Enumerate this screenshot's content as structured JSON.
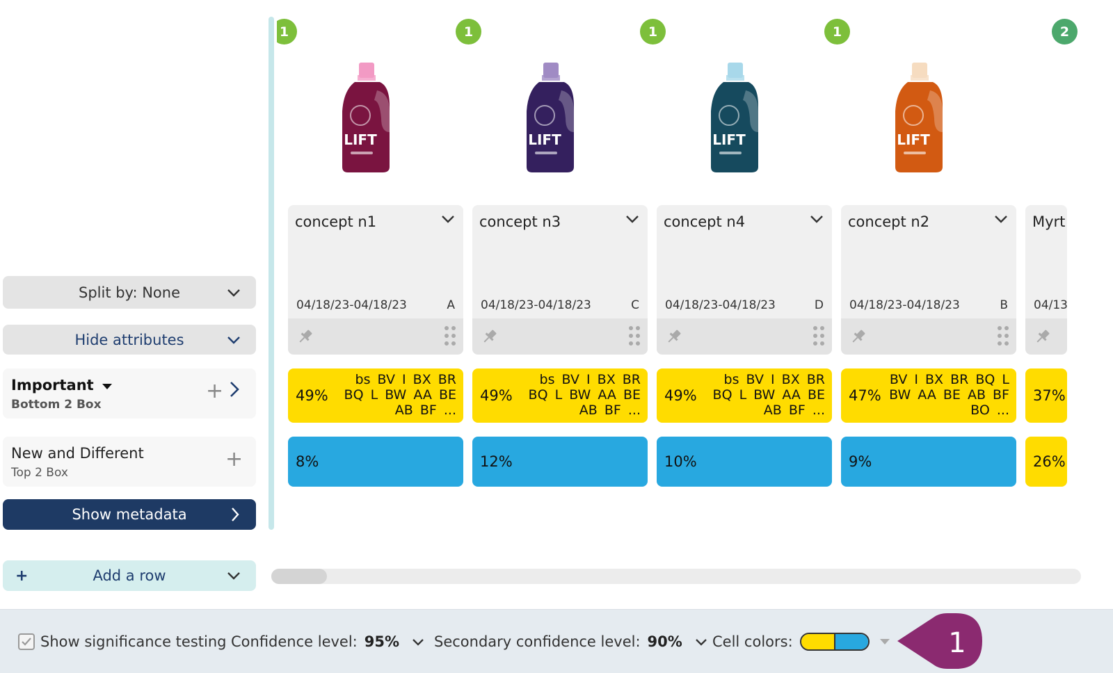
{
  "sidebar": {
    "split_label": "Split by: None",
    "hide_attributes_label": "Hide attributes",
    "attributes": [
      {
        "title": "Important",
        "subtitle": "Bottom 2 Box"
      },
      {
        "title": "New and Different",
        "subtitle": "Top 2 Box"
      }
    ],
    "show_metadata_label": "Show metadata",
    "add_row_label": "Add a row"
  },
  "columns": [
    {
      "badge": "1",
      "name": "concept n1",
      "date": "04/18/23-04/18/23",
      "letter": "A",
      "bottle_color": "#7a1440",
      "cap_color": "#f29ac4",
      "row1_pct": "49%",
      "row1_codes": "bs BV I BX BR BQ L BW AA BE AB BF ...",
      "row2_pct": "8%"
    },
    {
      "badge": "1",
      "name": "concept n3",
      "date": "04/18/23-04/18/23",
      "letter": "C",
      "bottle_color": "#34205e",
      "cap_color": "#a08bc4",
      "row1_pct": "49%",
      "row1_codes": "bs BV I BX BR BQ L BW AA BE AB BF ...",
      "row2_pct": "12%"
    },
    {
      "badge": "1",
      "name": "concept n4",
      "date": "04/18/23-04/18/23",
      "letter": "D",
      "bottle_color": "#164a5e",
      "cap_color": "#a8d8ea",
      "row1_pct": "49%",
      "row1_codes": "bs BV I BX BR BQ L BW AA BE AB BF ...",
      "row2_pct": "10%"
    },
    {
      "badge": "1",
      "name": "concept n2",
      "date": "04/18/23-04/18/23",
      "letter": "B",
      "bottle_color": "#d25a12",
      "cap_color": "#f6dcc0",
      "row1_pct": "47%",
      "row1_codes": "BV I BX BR BQ L BW AA BE AB BF BO ...",
      "row2_pct": "9%"
    },
    {
      "badge": "2",
      "name": "Myrt",
      "date": "04/13",
      "letter": "",
      "bottle_color": "",
      "cap_color": "",
      "row1_pct": "37%",
      "row1_codes": "",
      "row2_pct": "26%"
    }
  ],
  "footer": {
    "sig_label": "Show significance testing",
    "confidence_label": "Confidence level:",
    "confidence_value": "95%",
    "secondary_label": "Secondary confidence level:",
    "secondary_value": "90%",
    "cell_colors_label": "Cell colors:",
    "callout_number": "1"
  },
  "colors": {
    "badge_green": "#7dbf3b",
    "badge_green_dark": "#4ca86c",
    "yellow": "#ffdc00",
    "blue": "#28a8e0",
    "navy": "#1e3a64",
    "callout": "#8b2a70"
  }
}
